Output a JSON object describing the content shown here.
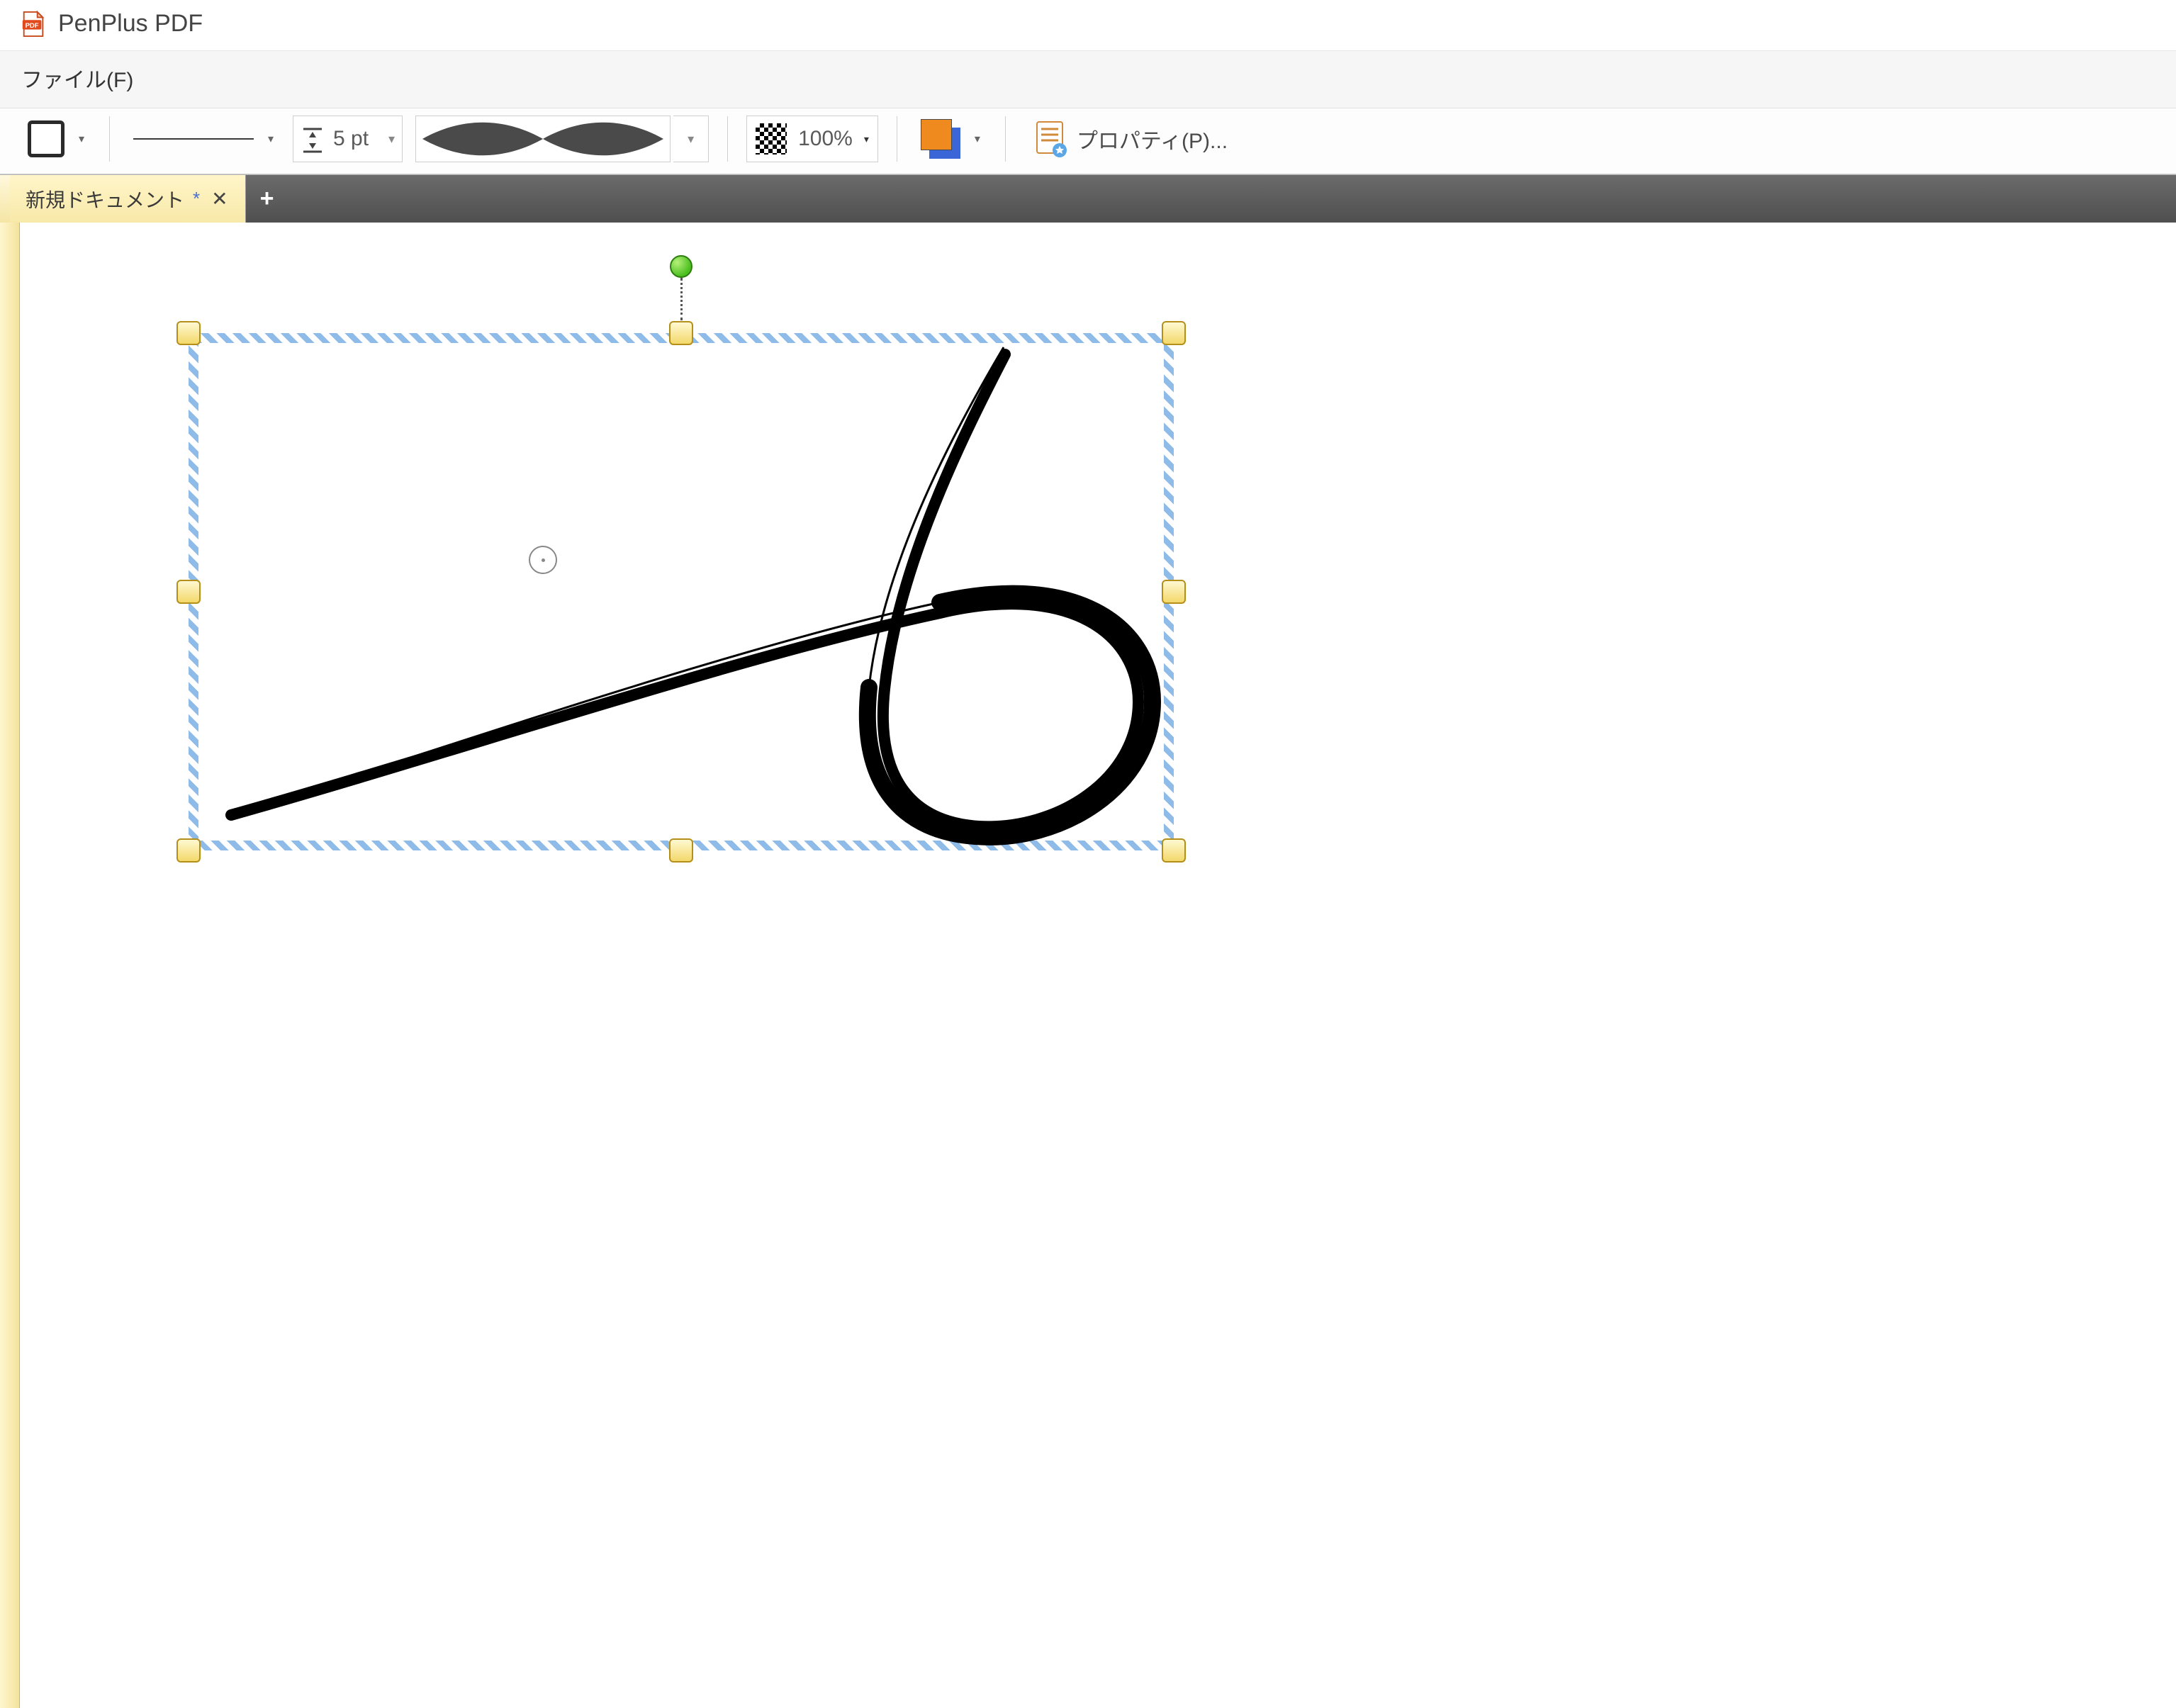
{
  "app": {
    "title": "PenPlus PDF",
    "icon_name": "pdf-app-icon"
  },
  "menubar": {
    "file": "ファイル(F)"
  },
  "toolbar": {
    "line_width": {
      "value": "5 pt"
    },
    "opacity": {
      "value": "100%"
    },
    "properties_label": "プロパティ(P)...",
    "colors": {
      "front": "#ef8a1f",
      "back": "#3a66d8"
    }
  },
  "tabs": {
    "items": [
      {
        "label": "新規ドキュメント",
        "dirty": "*",
        "active": true
      }
    ],
    "new_tab_glyph": "+"
  },
  "selection": {
    "has_selection": true,
    "handles": 8,
    "rotation_handle": true
  }
}
